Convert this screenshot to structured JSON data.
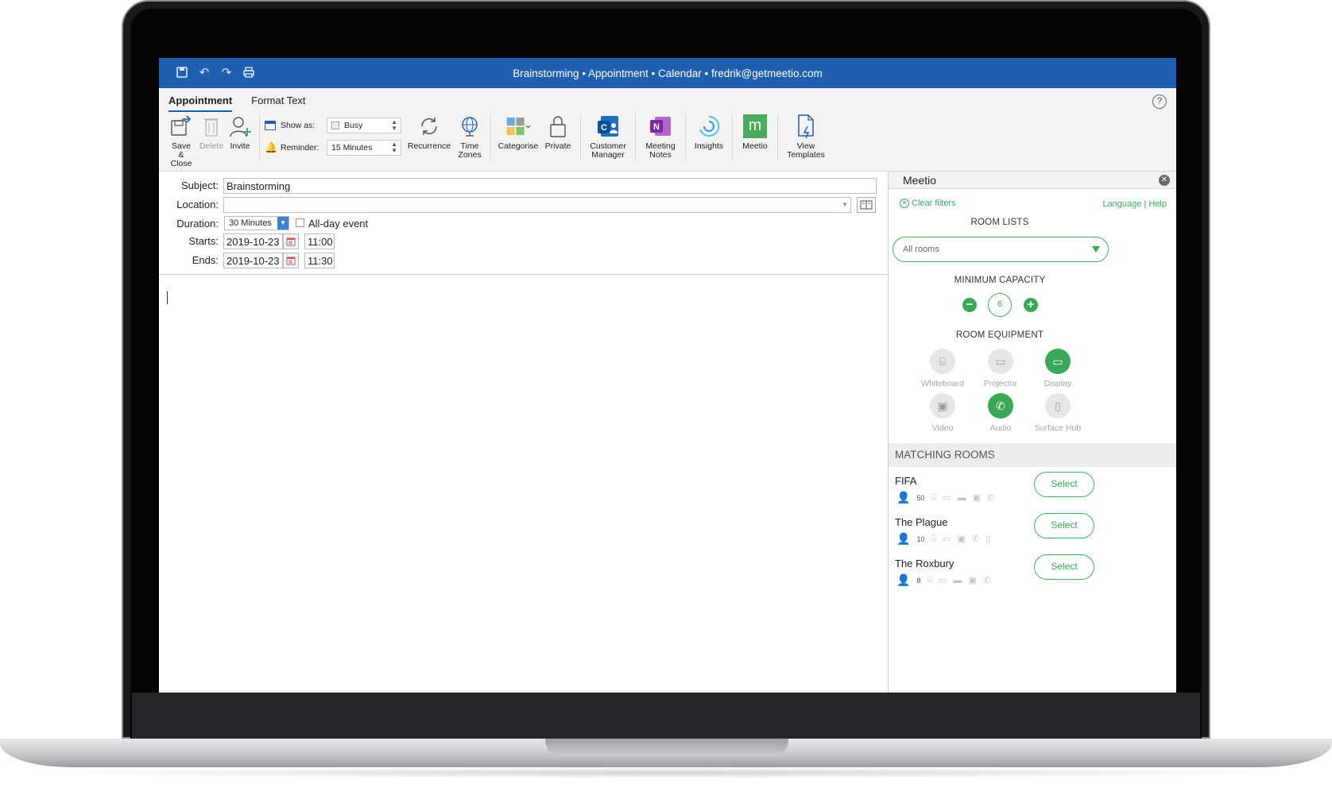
{
  "window": {
    "title": "Brainstorming • Appointment • Calendar • fredrik@getmeetio.com"
  },
  "tabs": [
    {
      "label": "Appointment"
    },
    {
      "label": "Format Text"
    }
  ],
  "toolbar": {
    "save_close": "Save & Close",
    "delete": "Delete",
    "invite": "Invite",
    "show_as_label": "Show as:",
    "show_as_value": "Busy",
    "reminder_label": "Reminder:",
    "reminder_value": "15 Minutes",
    "recurrence": "Recurrence",
    "time_zones": "Time Zones",
    "categorise": "Categorise",
    "private": "Private",
    "customer_manager": "Customer Manager",
    "meeting_notes": "Meeting Notes",
    "insights": "Insights",
    "meetio": "Meetio",
    "view_templates": "View Templates"
  },
  "form": {
    "subject_label": "Subject:",
    "subject_value": "Brainstorming",
    "location_label": "Location:",
    "location_value": "",
    "duration_label": "Duration:",
    "duration_value": "30 Minutes",
    "all_day_label": "All-day event",
    "starts_label": "Starts:",
    "starts_date": "2019-10-23",
    "starts_time": "11:00",
    "ends_label": "Ends:",
    "ends_date": "2019-10-23",
    "ends_time": "11:30"
  },
  "panel": {
    "title": "Meetio",
    "clear_filters": "Clear filters",
    "language": "Language",
    "help": "Help",
    "room_lists_title": "ROOM LISTS",
    "room_lists_value": "All rooms",
    "min_capacity_title": "MINIMUM CAPACITY",
    "min_capacity_value": "6",
    "equipment_title": "ROOM EQUIPMENT",
    "equipment": [
      {
        "label": "Whiteboard",
        "selected": false
      },
      {
        "label": "Projector",
        "selected": false
      },
      {
        "label": "Display",
        "selected": true
      },
      {
        "label": "Video",
        "selected": false
      },
      {
        "label": "Audio",
        "selected": true
      },
      {
        "label": "Surface Hub",
        "selected": false
      }
    ],
    "matching_title": "MATCHING ROOMS",
    "rooms": [
      {
        "name": "FIFA",
        "capacity": "50",
        "select": "Select"
      },
      {
        "name": "The Plague",
        "capacity": "10",
        "select": "Select"
      },
      {
        "name": "The Roxbury",
        "capacity": "8",
        "select": "Select"
      }
    ]
  },
  "colors": {
    "titlebar": "#1f5fb0",
    "accent_green": "#3aa957"
  }
}
